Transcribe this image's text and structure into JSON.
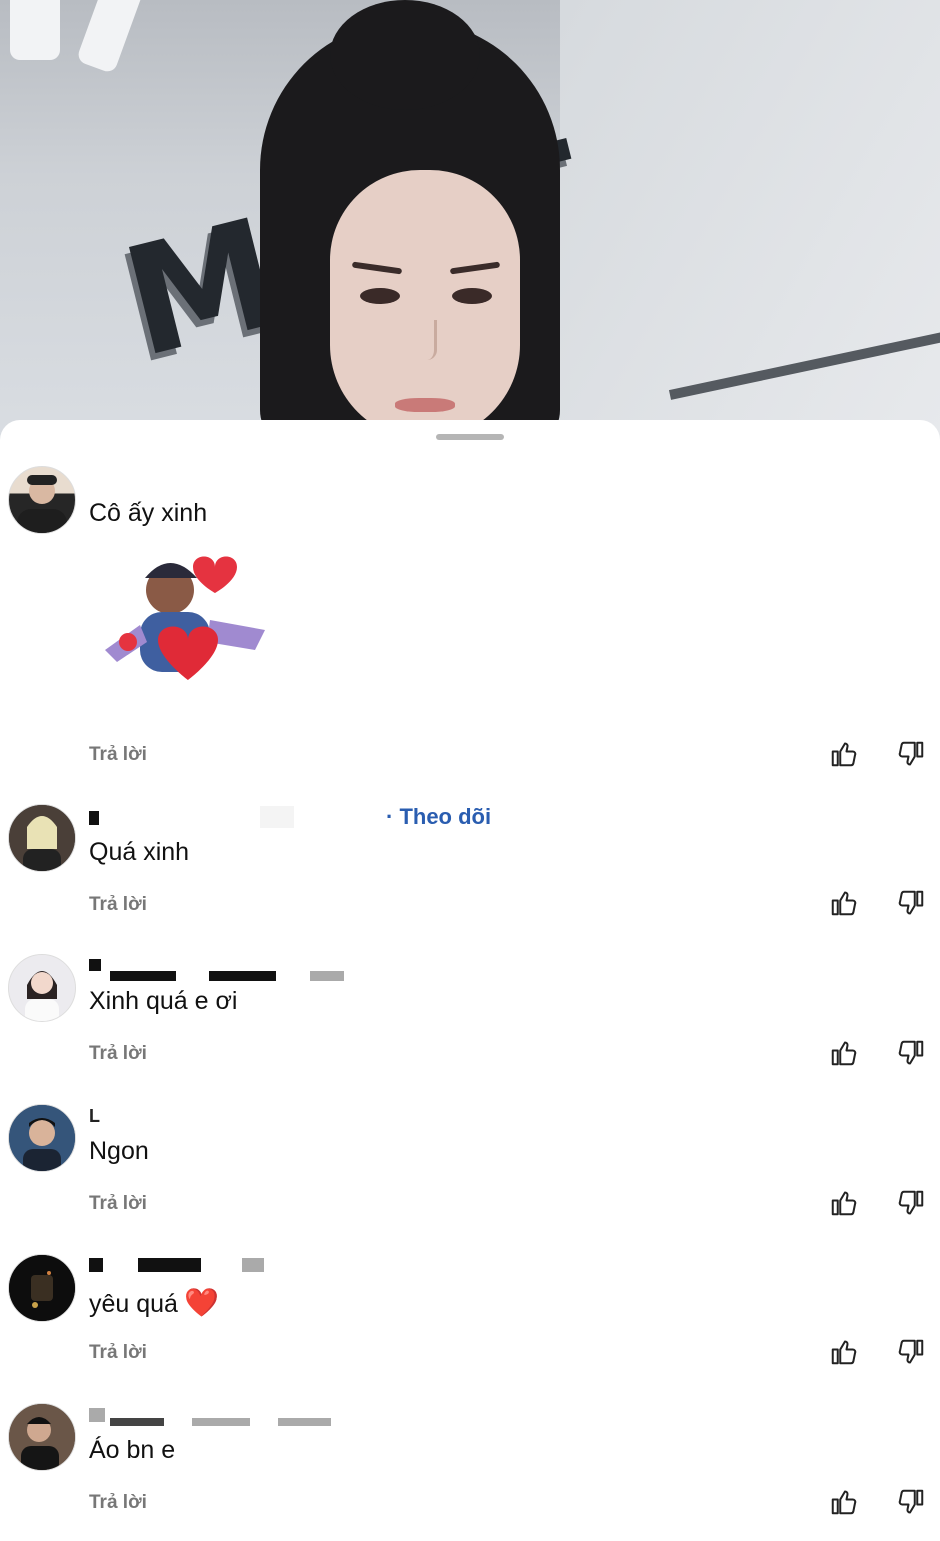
{
  "video": {
    "store_sign_text": "TRAM"
  },
  "comments": [
    {
      "username": "",
      "text": "Cô ấy xinh",
      "reply_label": "Trả lời",
      "has_sticker": true
    },
    {
      "username": "",
      "follow_label": "· Theo dõi",
      "text": "Quá xinh",
      "reply_label": "Trả lời"
    },
    {
      "username": "",
      "text": "Xinh quá e ơi",
      "reply_label": "Trả lời"
    },
    {
      "username": "L",
      "text": "Ngon",
      "reply_label": "Trả lời"
    },
    {
      "username": "",
      "text": "yêu quá",
      "emoji": "❤️",
      "reply_label": "Trả lời"
    },
    {
      "username": "",
      "text": "Áo bn e",
      "reply_label": "Trả lời"
    }
  ],
  "icons": {
    "like": "thumbs-up-icon",
    "dislike": "thumbs-down-icon"
  },
  "colors": {
    "follow": "#2a5db0",
    "reply": "#777777",
    "heart": "#e02525"
  }
}
